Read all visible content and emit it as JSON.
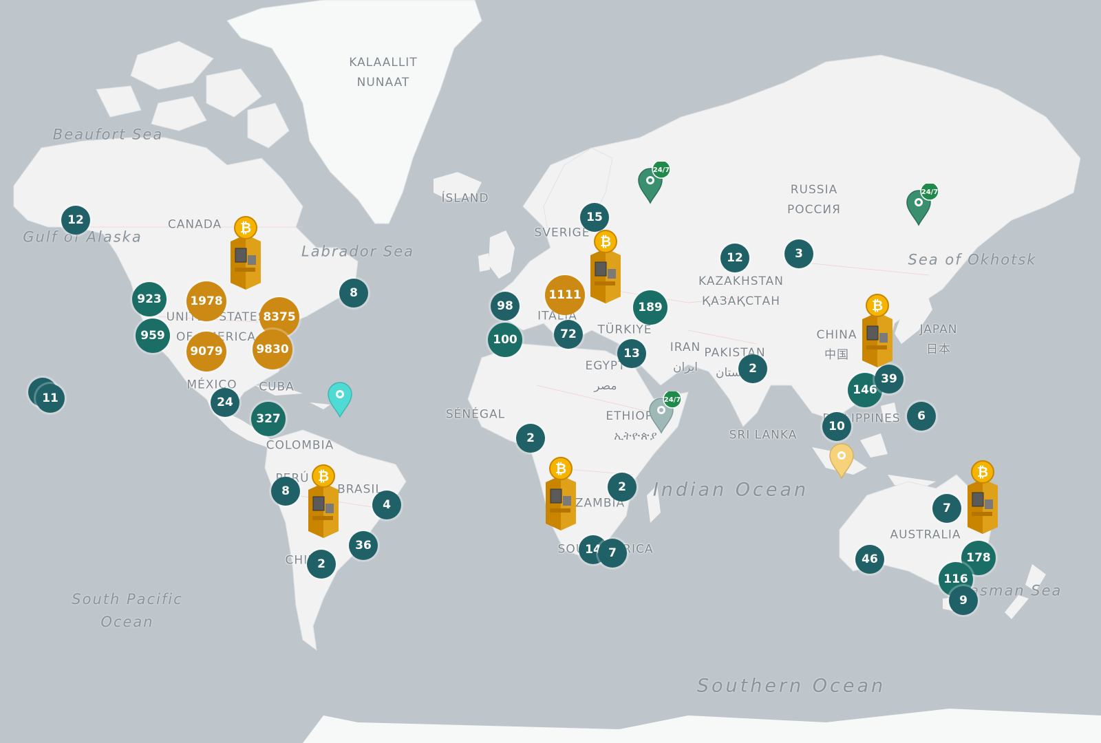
{
  "map": {
    "colors": {
      "water": "#bfc6cb",
      "land": "#f2f2f2",
      "ice": "#f7f8f8",
      "cluster_small": "#1f6166",
      "cluster_medium": "#1b6e66",
      "cluster_large": "#cc8a14",
      "pin_green": "#3a8f6f",
      "pin_cyan": "#4fdbd3",
      "pin_grey": "#9fb8b8",
      "pin_yellow": "#f6d27a"
    },
    "country_labels": [
      {
        "id": "greenland",
        "text": "KALAALLIT\nNUNAAT"
      },
      {
        "id": "canada",
        "text": "CANADA"
      },
      {
        "id": "usa",
        "text": "UNITED STATES\nOF AMERICA"
      },
      {
        "id": "mexico",
        "text": "MÉXICO"
      },
      {
        "id": "cuba",
        "text": "CUBA"
      },
      {
        "id": "colombia",
        "text": "COLOMBIA"
      },
      {
        "id": "peru",
        "text": "PERÚ"
      },
      {
        "id": "brasil",
        "text": "BRASIL"
      },
      {
        "id": "chile",
        "text": "CHILE"
      },
      {
        "id": "island",
        "text": "ÍSLAND"
      },
      {
        "id": "sverige",
        "text": "SVERIGE"
      },
      {
        "id": "italia",
        "text": "ITALIA"
      },
      {
        "id": "turkiye",
        "text": "TÜRKIYE"
      },
      {
        "id": "egypt",
        "text": "EGYPT\nمصر"
      },
      {
        "id": "senegal",
        "text": "SÉNÉGAL"
      },
      {
        "id": "ethiopia",
        "text": "ETHIOPIA\nኢትዮጵያ"
      },
      {
        "id": "zambia",
        "text": "ZAMBIA"
      },
      {
        "id": "southafrica",
        "text": "SOUTH AFRICA"
      },
      {
        "id": "russia",
        "text": "RUSSIA\nРОССИЯ"
      },
      {
        "id": "kazakhstan",
        "text": "KAZAKHSTAN\nҚАЗАҚСТАН"
      },
      {
        "id": "iran",
        "text": "IRAN\nایران"
      },
      {
        "id": "pakistan",
        "text": "PAKISTAN\nپاکستان"
      },
      {
        "id": "srilanka",
        "text": "SRI LANKA"
      },
      {
        "id": "china",
        "text": "CHINA\n中国"
      },
      {
        "id": "japan",
        "text": "JAPAN\n日本"
      },
      {
        "id": "philippines",
        "text": "PHILIPPINES"
      },
      {
        "id": "australia",
        "text": "AUSTRALIA"
      }
    ],
    "sea_labels": [
      {
        "id": "beaufort",
        "text": "Beaufort Sea"
      },
      {
        "id": "alaska",
        "text": "Gulf of Alaska"
      },
      {
        "id": "labrador",
        "text": "Labrador Sea"
      },
      {
        "id": "okhotsk",
        "text": "Sea of Okhotsk"
      },
      {
        "id": "tasman",
        "text": "Tasman Sea"
      },
      {
        "id": "southpacific",
        "text": "South Pacific\nOcean"
      }
    ],
    "ocean_labels": [
      {
        "id": "indian",
        "text": "Indian Ocean"
      },
      {
        "id": "southern",
        "text": "Southern Ocean"
      }
    ],
    "clusters": [
      {
        "id": "alaska",
        "count": "12",
        "tier": "small"
      },
      {
        "id": "hawaii-a",
        "count": "",
        "tier": "small"
      },
      {
        "id": "hawaii",
        "count": "11",
        "tier": "small"
      },
      {
        "id": "us-nw",
        "count": "923",
        "tier": "medium"
      },
      {
        "id": "us-west",
        "count": "959",
        "tier": "medium"
      },
      {
        "id": "us-central",
        "count": "1978",
        "tier": "large"
      },
      {
        "id": "us-ne",
        "count": "8375",
        "tier": "large"
      },
      {
        "id": "us-south",
        "count": "9079",
        "tier": "large"
      },
      {
        "id": "us-se",
        "count": "9830",
        "tier": "large"
      },
      {
        "id": "canada-east",
        "count": "8",
        "tier": "small"
      },
      {
        "id": "mexico",
        "count": "24",
        "tier": "small"
      },
      {
        "id": "central-am",
        "count": "327",
        "tier": "medium"
      },
      {
        "id": "peru",
        "count": "8",
        "tier": "small"
      },
      {
        "id": "brasil",
        "count": "4",
        "tier": "small"
      },
      {
        "id": "brasil-s",
        "count": "36",
        "tier": "small"
      },
      {
        "id": "chile",
        "count": "2",
        "tier": "small"
      },
      {
        "id": "sweden",
        "count": "15",
        "tier": "small"
      },
      {
        "id": "uk",
        "count": "98",
        "tier": "small"
      },
      {
        "id": "spain",
        "count": "100",
        "tier": "medium"
      },
      {
        "id": "europe",
        "count": "1111",
        "tier": "large"
      },
      {
        "id": "italy",
        "count": "72",
        "tier": "small"
      },
      {
        "id": "balkans",
        "count": "189",
        "tier": "medium"
      },
      {
        "id": "mideast",
        "count": "13",
        "tier": "small"
      },
      {
        "id": "kazakh",
        "count": "12",
        "tier": "small"
      },
      {
        "id": "siberia",
        "count": "3",
        "tier": "small"
      },
      {
        "id": "india",
        "count": "2",
        "tier": "small"
      },
      {
        "id": "china-s",
        "count": "146",
        "tier": "medium"
      },
      {
        "id": "taiwan",
        "count": "39",
        "tier": "small"
      },
      {
        "id": "philippines",
        "count": "6",
        "tier": "small"
      },
      {
        "id": "vietnam",
        "count": "10",
        "tier": "small"
      },
      {
        "id": "w-africa",
        "count": "2",
        "tier": "small"
      },
      {
        "id": "e-africa",
        "count": "2",
        "tier": "small"
      },
      {
        "id": "s-africa-a",
        "count": "14",
        "tier": "small"
      },
      {
        "id": "s-africa-b",
        "count": "7",
        "tier": "small"
      },
      {
        "id": "aus-n",
        "count": "7",
        "tier": "small"
      },
      {
        "id": "aus-w",
        "count": "46",
        "tier": "small"
      },
      {
        "id": "aus-e",
        "count": "178",
        "tier": "medium"
      },
      {
        "id": "aus-se",
        "count": "116",
        "tier": "medium"
      },
      {
        "id": "tasmania",
        "count": "9",
        "tier": "small"
      }
    ],
    "pins": [
      {
        "id": "st-petersburg",
        "color": "#3a8f6f",
        "badge": "24/7"
      },
      {
        "id": "yakutia",
        "color": "#3a8f6f",
        "badge": "24/7"
      },
      {
        "id": "ethiopia",
        "color": "#9fb8b8",
        "badge": "24/7"
      },
      {
        "id": "caribbean",
        "color": "#4fdbd3",
        "badge": ""
      },
      {
        "id": "indonesia",
        "color": "#f6d27a",
        "badge": ""
      }
    ],
    "atm_icons": [
      {
        "id": "north-america",
        "icon": "bitcoin-atm-icon"
      },
      {
        "id": "europe",
        "icon": "bitcoin-atm-icon"
      },
      {
        "id": "south-america",
        "icon": "bitcoin-atm-icon"
      },
      {
        "id": "africa",
        "icon": "bitcoin-atm-icon"
      },
      {
        "id": "east-asia",
        "icon": "bitcoin-atm-icon"
      },
      {
        "id": "australia",
        "icon": "bitcoin-atm-icon"
      }
    ]
  }
}
